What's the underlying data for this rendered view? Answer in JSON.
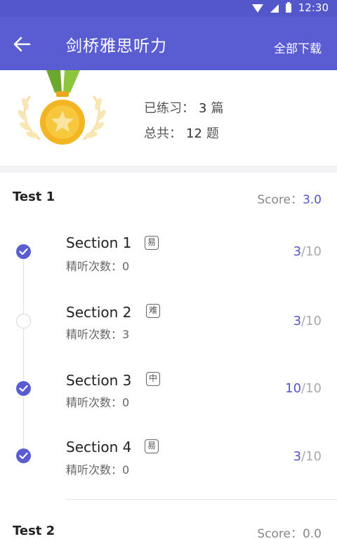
{
  "status_bar": {
    "time": "12:30"
  },
  "app_bar": {
    "title": "剑桥雅思听力",
    "download_all": "全部下载"
  },
  "summary": {
    "practiced_label": "已练习：",
    "practiced_count": "3",
    "practiced_unit": "篇",
    "total_label": "总共：",
    "total_count": "12",
    "total_unit": "题"
  },
  "tests": [
    {
      "name": "Test 1",
      "score_label": "Score：",
      "score": "3.0",
      "sections": [
        {
          "title": "Section 1",
          "difficulty": "易",
          "plays_label": "精听次数：",
          "plays": "0",
          "done": "3",
          "total": "/10",
          "completed": true
        },
        {
          "title": "Section 2",
          "difficulty": "难",
          "plays_label": "精听次数：",
          "plays": "3",
          "done": "3",
          "total": "/10",
          "completed": false
        },
        {
          "title": "Section 3",
          "difficulty": "中",
          "plays_label": "精听次数：",
          "plays": "0",
          "done": "10",
          "total": "/10",
          "completed": true
        },
        {
          "title": "Section 4",
          "difficulty": "易",
          "plays_label": "精听次数：",
          "plays": "0",
          "done": "3",
          "total": "/10",
          "completed": true
        }
      ]
    },
    {
      "name": "Test 2",
      "score_label": "Score：",
      "score": "0.0"
    }
  ],
  "colors": {
    "primary": "#5a5dd1",
    "accent": "#5457c9",
    "medal_gold": "#f4b524",
    "ribbon_green": "#8cc63f"
  }
}
